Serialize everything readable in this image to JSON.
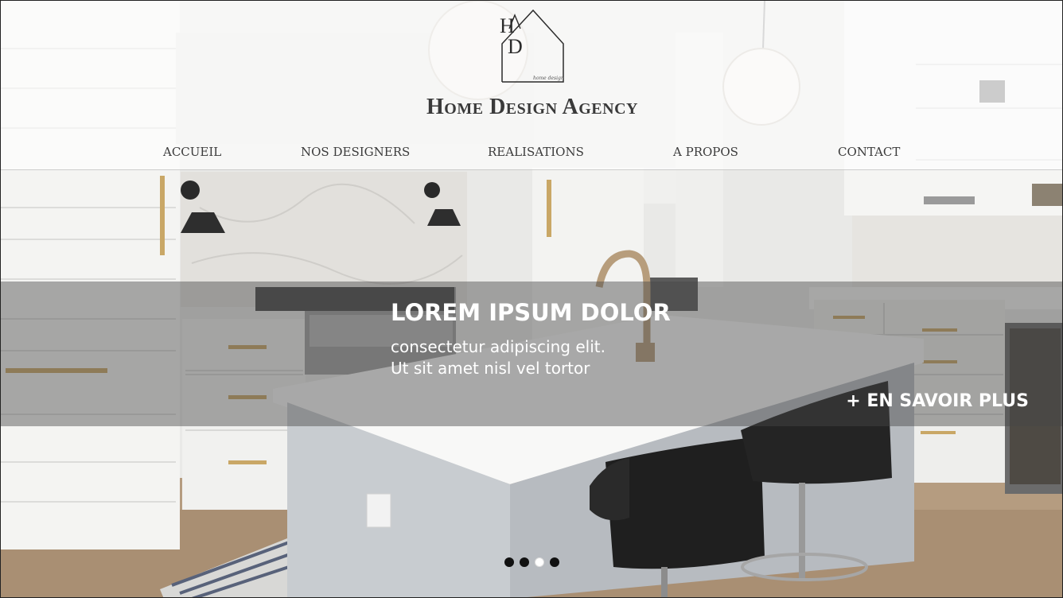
{
  "brand": {
    "logo_name": "had-house-logo",
    "logo_script": "home design",
    "title": "Home Design Agency"
  },
  "nav": {
    "items": [
      {
        "label": "ACCUEIL"
      },
      {
        "label": "NOS DESIGNERS"
      },
      {
        "label": "REALISATIONS"
      },
      {
        "label": "A PROPOS"
      },
      {
        "label": "CONTACT"
      }
    ]
  },
  "hero": {
    "title": "LOREM IPSUM DOLOR",
    "subtitle_line1": "consectetur adipiscing elit.",
    "subtitle_line2": "Ut sit amet nisl vel tortor",
    "cta_label": "+ EN SAVOIR PLUS"
  },
  "carousel": {
    "count": 4,
    "active_index": 2
  },
  "colors": {
    "text_dark": "#3a3a3a",
    "overlay_band": "#464646",
    "cta_text": "#ffffff"
  }
}
